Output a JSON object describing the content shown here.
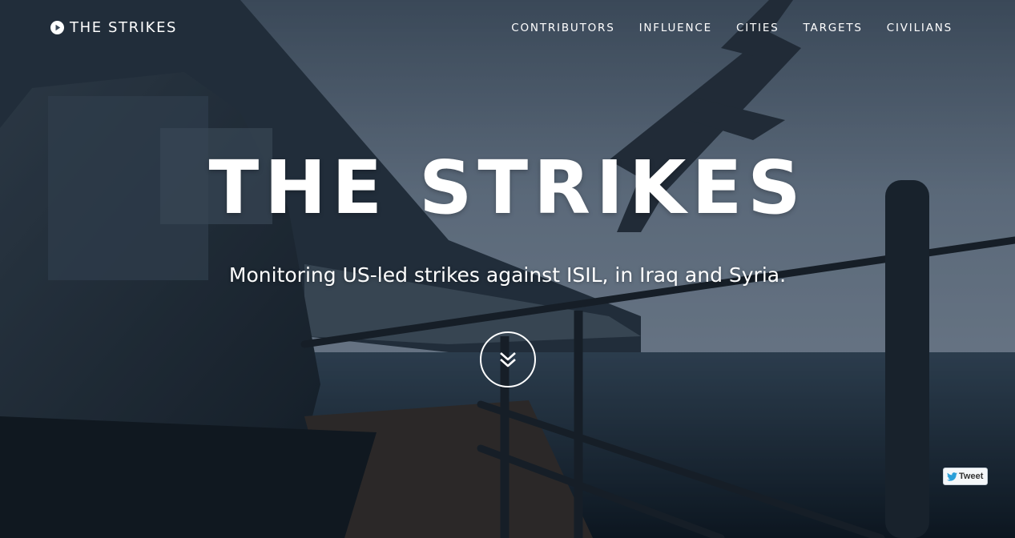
{
  "brand": {
    "name": "THE STRIKES",
    "icon": "play-circle-icon"
  },
  "nav": {
    "items": [
      {
        "label": "CONTRIBUTORS"
      },
      {
        "label": "INFLUENCE"
      },
      {
        "label": "CITIES"
      },
      {
        "label": "TARGETS"
      },
      {
        "label": "CIVILIANS"
      }
    ]
  },
  "hero": {
    "title": "THE STRIKES",
    "subtitle": "Monitoring US-led strikes against ISIL, in Iraq and Syria.",
    "scroll_icon": "double-chevron-down-icon"
  },
  "share": {
    "tweet_label": "Tweet",
    "icon": "twitter-bird-icon"
  },
  "colors": {
    "text": "#ffffff",
    "sky": "#63748a",
    "sea": "#1c2b3a"
  }
}
